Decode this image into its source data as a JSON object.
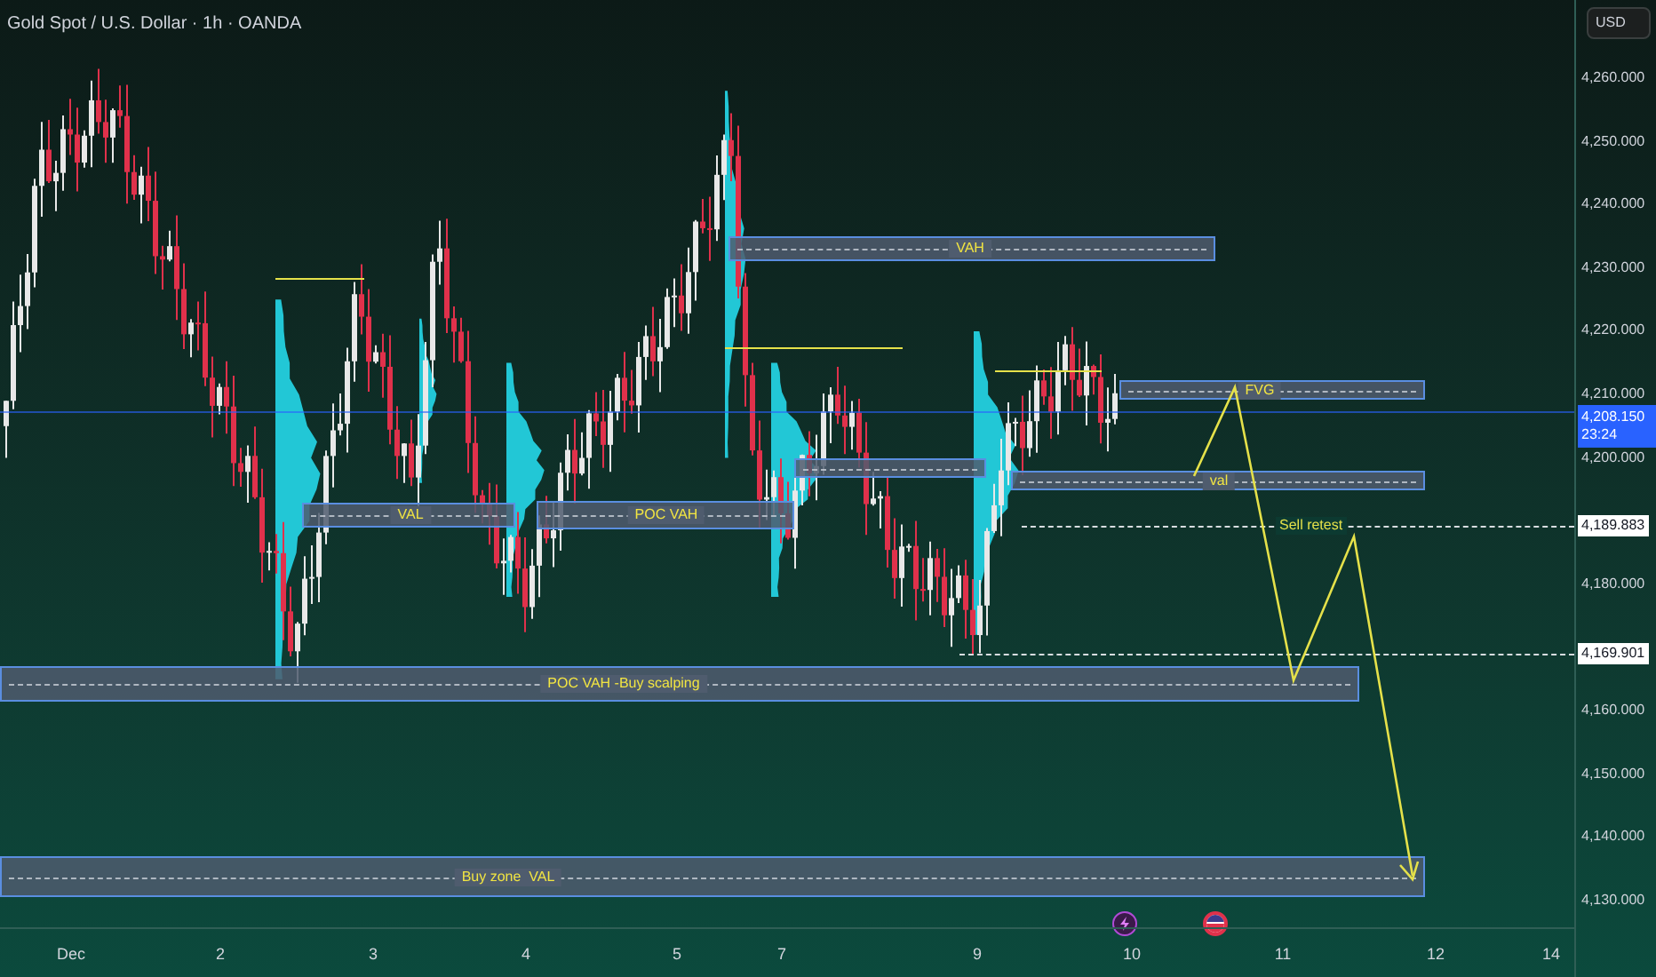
{
  "title": "Gold Spot / U.S. Dollar · 1h · OANDA",
  "currency": "USD",
  "price_axis": [
    "4,260.000",
    "4,250.000",
    "4,240.000",
    "4,230.000",
    "4,220.000",
    "4,210.000",
    "4,200.000",
    "4,180.000",
    "4,160.000",
    "4,150.000",
    "4,140.000",
    "4,130.000"
  ],
  "time_axis": [
    "Dec",
    "2",
    "3",
    "4",
    "5",
    "7",
    "9",
    "10",
    "11",
    "12",
    "14"
  ],
  "last_price": {
    "price": "4,208.150",
    "countdown": "23:24"
  },
  "levels": [
    {
      "price": "4,189.883",
      "label": "Sell retest"
    },
    {
      "price": "4,169.901"
    }
  ],
  "zones": [
    {
      "label": "VAH"
    },
    {
      "label": "FVG"
    },
    {
      "label": "val"
    },
    {
      "label": "VAL"
    },
    {
      "label": "POC VAH"
    },
    {
      "label": "POC VAH -Buy scalping"
    },
    {
      "label": "Buy zone  VAL"
    }
  ]
}
